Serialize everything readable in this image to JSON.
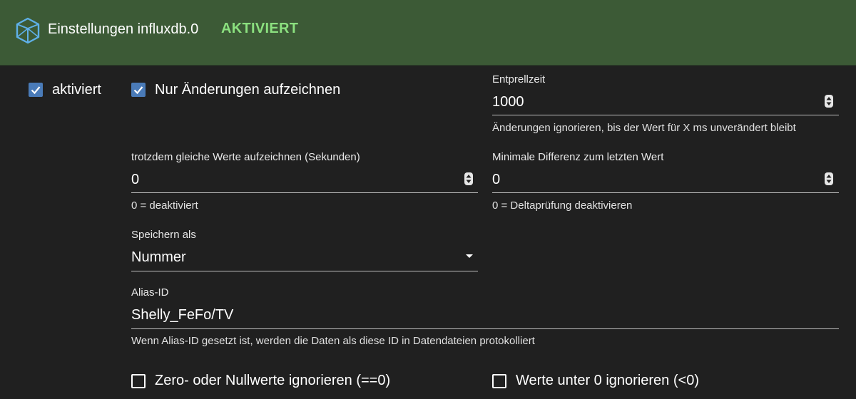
{
  "header": {
    "title": "Einstellungen influxdb.0",
    "status": "AKTIVIERT",
    "logo_icon": "influxdb-logo-icon",
    "background_color": "#3c5a36",
    "status_color": "#8be07f"
  },
  "checkboxes": {
    "enabled": {
      "label": "aktiviert",
      "checked": true
    },
    "changes_only": {
      "label": "Nur Änderungen aufzeichnen",
      "checked": true
    },
    "ignore_zero": {
      "label": "Zero- oder Nullwerte ignorieren (==0)",
      "checked": false
    },
    "ignore_below_zero": {
      "label": "Werte unter 0 ignorieren (<0)",
      "checked": false
    }
  },
  "fields": {
    "debounce": {
      "label": "Entprellzeit",
      "value": "1000",
      "help": "Änderungen ignorieren, bis der Wert für X ms unverändert bleibt"
    },
    "record_same_values": {
      "label": "trotzdem gleiche Werte aufzeichnen (Sekunden)",
      "value": "0",
      "help": "0 = deaktiviert"
    },
    "min_difference": {
      "label": "Minimale Differenz zum letzten Wert",
      "value": "0",
      "help": "0 = Deltaprüfung deaktivieren"
    },
    "store_as": {
      "label": "Speichern als",
      "value": "Nummer"
    },
    "alias_id": {
      "label": "Alias-ID",
      "value": "Shelly_FeFo/TV",
      "help": "Wenn Alias-ID gesetzt ist, werden die Daten als diese ID in Datendateien protokolliert"
    }
  },
  "colors": {
    "background": "#202020",
    "checkbox_checked": "#4a7bb8"
  }
}
